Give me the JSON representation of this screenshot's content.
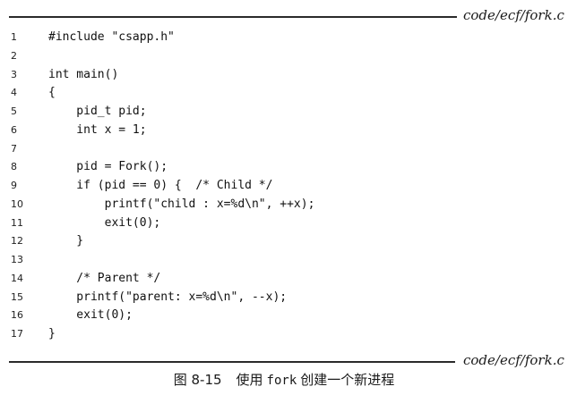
{
  "document": {
    "file_label_top": "code/ecf/fork.c",
    "file_label_bottom": "code/ecf/fork.c",
    "code_lines": [
      {
        "num": "1",
        "text": "#include \"csapp.h\""
      },
      {
        "num": "2",
        "text": ""
      },
      {
        "num": "3",
        "text": "int main()"
      },
      {
        "num": "4",
        "text": "{"
      },
      {
        "num": "5",
        "text": "    pid_t pid;"
      },
      {
        "num": "6",
        "text": "    int x = 1;"
      },
      {
        "num": "7",
        "text": ""
      },
      {
        "num": "8",
        "text": "    pid = Fork();"
      },
      {
        "num": "9",
        "text": "    if (pid == 0) {  /* Child */"
      },
      {
        "num": "10",
        "text": "        printf(\"child : x=%d\\n\", ++x);"
      },
      {
        "num": "11",
        "text": "        exit(0);"
      },
      {
        "num": "12",
        "text": "    }"
      },
      {
        "num": "13",
        "text": ""
      },
      {
        "num": "14",
        "text": "    /* Parent */"
      },
      {
        "num": "15",
        "text": "    printf(\"parent: x=%d\\n\", --x);"
      },
      {
        "num": "16",
        "text": "    exit(0);"
      },
      {
        "num": "17",
        "text": "}"
      }
    ],
    "caption": {
      "figure_number": "图 8-15",
      "text_before": "使用",
      "code_word": "fork",
      "text_after": "创建一个新进程"
    }
  }
}
